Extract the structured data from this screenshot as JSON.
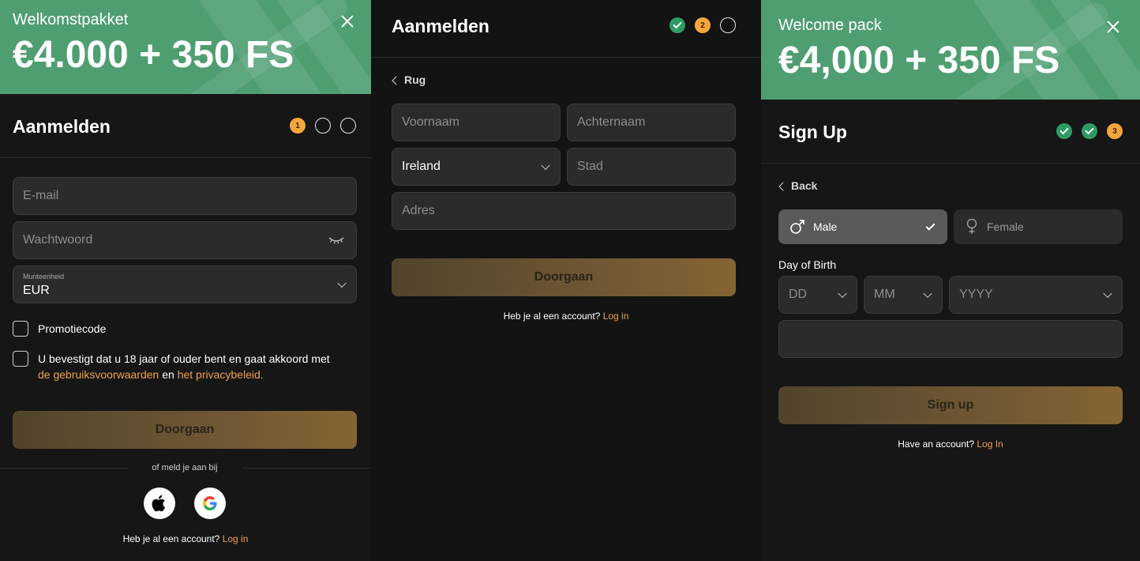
{
  "panel1": {
    "banner_title": "Welkomstpakket",
    "banner_amount": "€4.000 + 350 FS",
    "heading": "Aanmelden",
    "steps": [
      "1",
      "",
      ""
    ],
    "email_placeholder": "E-mail",
    "password_placeholder": "Wachtwoord",
    "currency_label": "Munteenheid",
    "currency_value": "EUR",
    "promo_label": "Promotiecode",
    "terms_text": "U bevestigt dat u 18 jaar of ouder bent en gaat akkoord met",
    "terms_link": "de gebruiksvoorwaarden",
    "terms_and": "en",
    "privacy_link": "het privacybeleid.",
    "continue_label": "Doorgaan",
    "or_text": "of meld je aan bij",
    "account_text": "Heb je al een account?",
    "login_link": "Log in"
  },
  "panel2": {
    "heading": "Aanmelden",
    "steps": [
      "",
      "2",
      ""
    ],
    "back_label": "Rug",
    "firstname_placeholder": "Voornaam",
    "lastname_placeholder": "Achternaam",
    "country_value": "Ireland",
    "city_placeholder": "Stad",
    "address_placeholder": "Adres",
    "continue_label": "Doorgaan",
    "account_text": "Heb je al een account?",
    "login_link": "Log in"
  },
  "panel3": {
    "banner_title": "Welcome pack",
    "banner_amount": "€4,000 + 350 FS",
    "heading": "Sign Up",
    "steps": [
      "",
      "",
      "3"
    ],
    "back_label": "Back",
    "male_label": "Male",
    "female_label": "Female",
    "dob_label": "Day of Birth",
    "day_placeholder": "DD",
    "month_placeholder": "MM",
    "year_placeholder": "YYYY",
    "signup_label": "Sign up",
    "account_text": "Have an account?",
    "login_link": "Log In"
  },
  "colors": {
    "banner_green": "#4f9e72",
    "accent_orange": "#f5a53d",
    "check_green": "#2e9b63",
    "link_orange": "#f0a04b"
  }
}
